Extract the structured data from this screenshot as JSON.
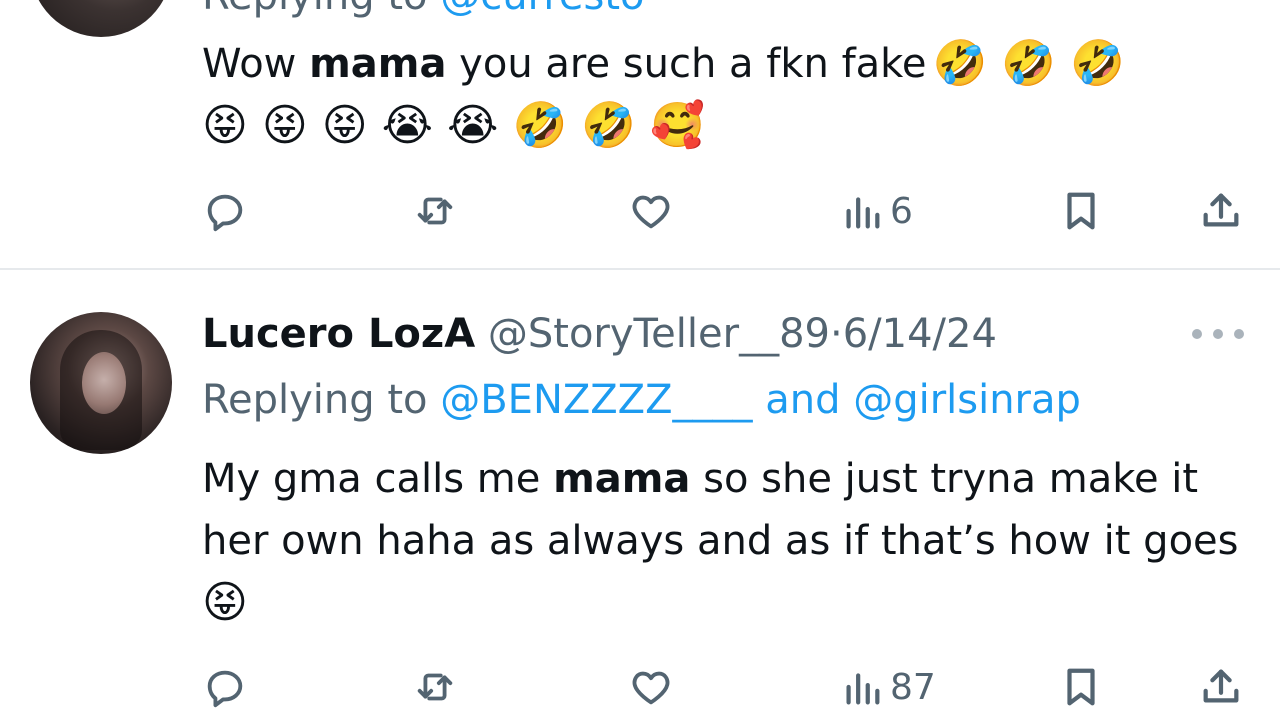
{
  "tweets": [
    {
      "replying_prefix": "Replying to",
      "replying_to": "@curresto",
      "text_before": "Wow ",
      "text_bold": "mama",
      "text_after": " you are such a fkn fake",
      "emojis_line1": [
        "🤣",
        "🤣",
        "🤣"
      ],
      "emojis_line2": [
        "😝",
        "😝",
        "😝",
        "😭",
        "😭",
        "🤣",
        "🤣",
        "🥰"
      ],
      "actions": {
        "replies": "",
        "retweets": "",
        "likes": "",
        "views": "6"
      }
    },
    {
      "display_name": "Lucero LozA",
      "handle": "@StoryTeller__89",
      "separator": "·",
      "date": "6/14/24",
      "replying_prefix": "Replying to",
      "replying_to_1": "@BENZZZZ____",
      "replying_and": "and",
      "replying_to_2": "@girlsinrap",
      "text_before": "My gma calls me ",
      "text_bold": "mama",
      "text_after": " so she just tryna make it her own haha as always and as if that’s how it goes",
      "emoji_end": "😝",
      "actions": {
        "replies": "",
        "retweets": "",
        "likes": "",
        "views": "87"
      }
    }
  ],
  "icons": {
    "reply": "reply-icon",
    "retweet": "retweet-icon",
    "like": "heart-icon",
    "views": "views-chart-icon",
    "bookmark": "bookmark-icon",
    "share": "share-icon",
    "more": "more-icon"
  },
  "colors": {
    "text": "#0f1419",
    "secondary": "#536471",
    "link": "#1d9bf0",
    "divider": "#e6e9ec"
  }
}
